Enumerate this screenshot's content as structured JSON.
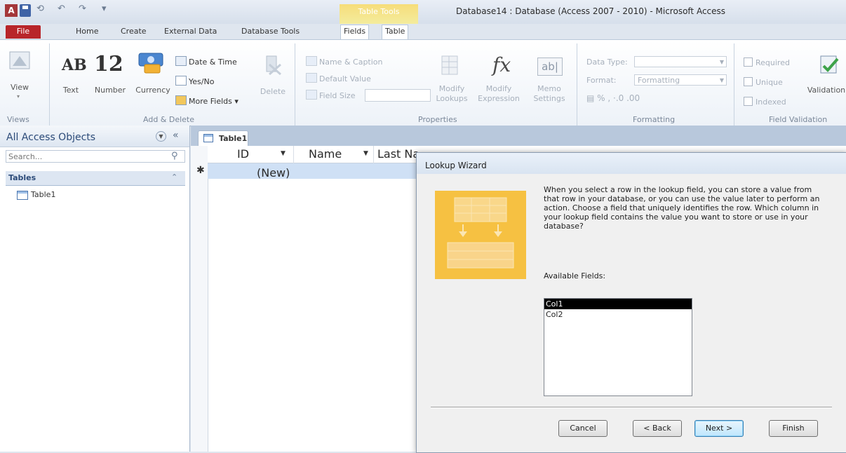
{
  "window": {
    "title": "Database14 : Database (Access 2007 - 2010)  -  Microsoft Access",
    "context_tab_group": "Table Tools"
  },
  "tabs": [
    "File",
    "Home",
    "Create",
    "External Data",
    "Database Tools",
    "Fields",
    "Table"
  ],
  "ribbon": {
    "views": {
      "view_label": "View",
      "group_label": "Views"
    },
    "add_delete": {
      "text_icon": "AB",
      "text_label": "Text",
      "number_icon": "12",
      "number_label": "Number",
      "currency_label": "Currency",
      "date_time": "Date & Time",
      "yes_no": "Yes/No",
      "more_fields": "More Fields",
      "delete": "Delete",
      "group_label": "Add & Delete"
    },
    "properties": {
      "name_caption": "Name & Caption",
      "default_value": "Default Value",
      "field_size": "Field Size",
      "modify_lookups": "Modify Lookups",
      "modify_expression": "Modify Expression",
      "memo_settings": "Memo Settings",
      "group_label": "Properties"
    },
    "formatting": {
      "data_type": "Data Type:",
      "format": "Format:",
      "format_value": "Formatting",
      "group_label": "Formatting"
    },
    "field_validation": {
      "required": "Required",
      "unique": "Unique",
      "indexed": "Indexed",
      "validation": "Validation",
      "group_label": "Field Validation"
    }
  },
  "nav": {
    "title": "All Access Objects",
    "search_placeholder": "Search...",
    "section": "Tables",
    "items": [
      "Table1"
    ]
  },
  "document": {
    "tab": "Table1",
    "columns": [
      "ID",
      "Name",
      "Last Na"
    ],
    "new_row_label": "(New)"
  },
  "dialog": {
    "title": "Lookup Wizard",
    "description": "When you select a row in the lookup field, you can store a value from that row in your database, or you can use the value later to perform an action.  Choose a field that uniquely identifies the row. Which column in your lookup field contains the value you want to store or use in your database?",
    "available_label": "Available Fields:",
    "fields": [
      "Col1",
      "Col2"
    ],
    "selected_index": 0,
    "buttons": {
      "cancel": "Cancel",
      "back": "< Back",
      "next": "Next >",
      "finish": "Finish"
    }
  }
}
